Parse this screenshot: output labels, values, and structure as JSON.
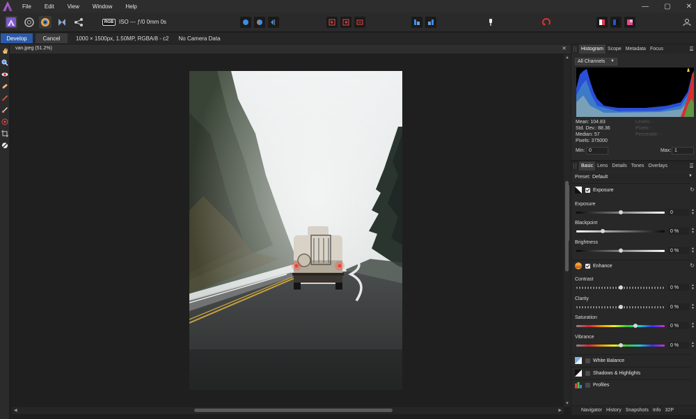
{
  "menu": [
    "File",
    "Edit",
    "View",
    "Window",
    "Help"
  ],
  "window_controls": [
    "—",
    "▢",
    "✕"
  ],
  "toolbar": {
    "rgb_badge": "RGB",
    "camera_info": "ISO --- ƒ/0 0mm 0s"
  },
  "context": {
    "develop_label": "Develop",
    "cancel_label": "Cancel",
    "image_info": "1000 × 1500px, 1.50MP, RGBA/8 - c2",
    "camera_data": "No Camera Data"
  },
  "document": {
    "tab_title": "van.jpeg (51.2%)",
    "close": "✕"
  },
  "histogram_panel": {
    "tabs": [
      "Histogram",
      "Scope",
      "Metadata",
      "Focus"
    ],
    "channel": "All Channels",
    "mean": "Mean: 104.83",
    "std_dev": "Std. Dev.: 88.36",
    "median": "Median: 57",
    "pixels": "Pixels: 375000",
    "levels": "Levels: -",
    "pixels_right": "Pixels: -",
    "percentile": "Percentile: -",
    "min_label": "Min:",
    "min_value": "0",
    "max_label": "Max:",
    "max_value": "1"
  },
  "develop_panel": {
    "tabs": [
      "Basic",
      "Lens",
      "Details",
      "Tones",
      "Overlays"
    ],
    "preset_label": "Preset:",
    "preset_value": "Default",
    "exposure_section": "Exposure",
    "enhance_section": "Enhance",
    "sliders": [
      {
        "label": "Exposure",
        "value": "0",
        "pos": 0.5
      },
      {
        "label": "Blackpoint",
        "value": "0 %",
        "pos": 0.3
      },
      {
        "label": "Brightness",
        "value": "0 %",
        "pos": 0.5
      },
      {
        "label": "Contrast",
        "value": "0 %",
        "pos": 0.5
      },
      {
        "label": "Clarity",
        "value": "0 %",
        "pos": 0.5
      },
      {
        "label": "Saturation",
        "value": "0 %",
        "pos": 0.67
      },
      {
        "label": "Vibrance",
        "value": "0 %",
        "pos": 0.5
      }
    ],
    "white_balance": "White Balance",
    "shadows_highlights": "Shadows & Highlights",
    "profiles": "Profiles"
  },
  "bottom_tabs": [
    "Navigator",
    "History",
    "Snapshots",
    "Info",
    "32P"
  ],
  "colors": {
    "accent": "#2c5aa8",
    "panel": "#2a2a2a",
    "canvas": "#1f1f1f"
  }
}
